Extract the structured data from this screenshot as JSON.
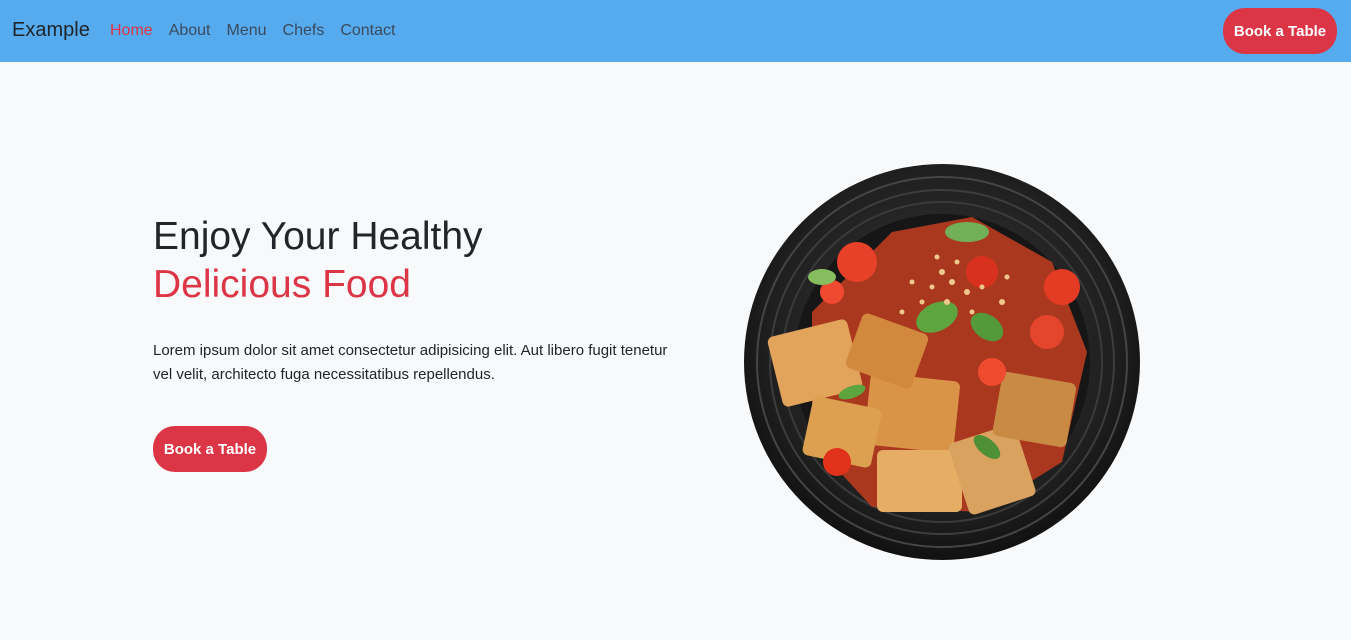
{
  "navbar": {
    "brand": "Example",
    "links": [
      {
        "label": "Home",
        "active": true
      },
      {
        "label": "About"
      },
      {
        "label": "Menu"
      },
      {
        "label": "Chefs"
      },
      {
        "label": "Contact"
      }
    ],
    "cta_label": "Book a Table"
  },
  "hero": {
    "title_line1": "Enjoy Your Healthy",
    "title_line2": "Delicious Food",
    "text": "Lorem ipsum dolor sit amet consectetur adipisicing elit. Aut libero fugit tenetur vel velit, architecto fuga necessitatibus repellendus.",
    "cta_label": "Book a Table"
  },
  "colors": {
    "navbar_bg": "#56abef",
    "accent": "#dc3545",
    "page_bg": "#f8f9fb",
    "text": "#212529"
  },
  "image": {
    "alt": "food-dish-image"
  }
}
